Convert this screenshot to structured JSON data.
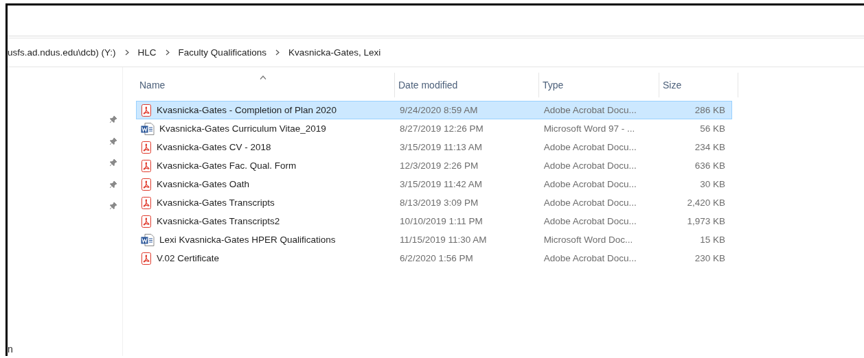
{
  "address_bar": {
    "segments": [
      {
        "label": "usfs.ad.ndus.edu\\dcb) (Y:)"
      },
      {
        "label": "HLC"
      },
      {
        "label": "Faculty Qualifications"
      },
      {
        "label": "Kvasnicka-Gates, Lexi"
      }
    ]
  },
  "navigation_pane": {
    "pinned_items": [
      {
        "pinned": true
      },
      {
        "pinned": true
      },
      {
        "pinned": true
      },
      {
        "pinned": true
      },
      {
        "pinned": true
      }
    ],
    "footer_text": "n"
  },
  "table": {
    "columns": [
      {
        "label": "Name",
        "sorted": true
      },
      {
        "label": "Date modified",
        "sorted": false
      },
      {
        "label": "Type",
        "sorted": false
      },
      {
        "label": "Size",
        "sorted": false
      }
    ],
    "rows": [
      {
        "kind": "pdf",
        "name": "Kvasnicka-Gates - Completion of Plan 2020",
        "date": "9/24/2020 8:59 AM",
        "type": "Adobe Acrobat Docu...",
        "size": "286 KB",
        "selected": true
      },
      {
        "kind": "word",
        "name": "Kvasnicka-Gates Curriculum Vitae_2019",
        "date": "8/27/2019 12:26 PM",
        "type": "Microsoft Word 97 - ...",
        "size": "56 KB",
        "selected": false
      },
      {
        "kind": "pdf",
        "name": "Kvasnicka-Gates CV - 2018",
        "date": "3/15/2019 11:13 AM",
        "type": "Adobe Acrobat Docu...",
        "size": "234 KB",
        "selected": false
      },
      {
        "kind": "pdf",
        "name": "Kvasnicka-Gates Fac. Qual. Form",
        "date": "12/3/2019 2:26 PM",
        "type": "Adobe Acrobat Docu...",
        "size": "636 KB",
        "selected": false
      },
      {
        "kind": "pdf",
        "name": "Kvasnicka-Gates Oath",
        "date": "3/15/2019 11:42 AM",
        "type": "Adobe Acrobat Docu...",
        "size": "30 KB",
        "selected": false
      },
      {
        "kind": "pdf",
        "name": "Kvasnicka-Gates Transcripts",
        "date": "8/13/2019 3:09 PM",
        "type": "Adobe Acrobat Docu...",
        "size": "2,420 KB",
        "selected": false
      },
      {
        "kind": "pdf",
        "name": "Kvasnicka-Gates Transcripts2",
        "date": "10/10/2019 1:11 PM",
        "type": "Adobe Acrobat Docu...",
        "size": "1,973 KB",
        "selected": false
      },
      {
        "kind": "word",
        "name": "Lexi Kvasnicka-Gates HPER Qualifications",
        "date": "11/15/2019 11:30 AM",
        "type": "Microsoft Word Doc...",
        "size": "15 KB",
        "selected": false
      },
      {
        "kind": "pdf",
        "name": "V.02 Certificate",
        "date": "6/2/2020 1:56 PM",
        "type": "Adobe Acrobat Docu...",
        "size": "230 KB",
        "selected": false
      }
    ]
  }
}
